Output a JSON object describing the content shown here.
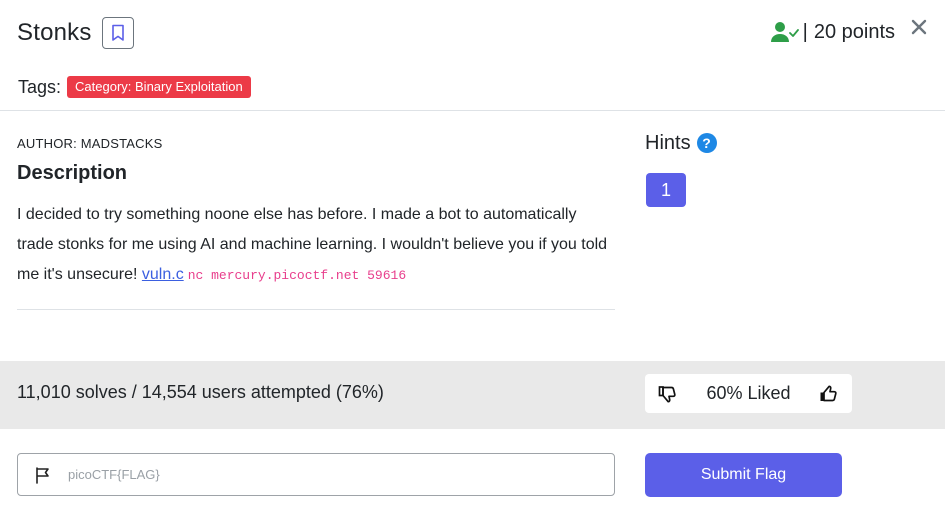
{
  "challenge": {
    "title": "Stonks",
    "points": "20 points",
    "separator": "|",
    "close_glyph": "✕"
  },
  "tags": {
    "label": "Tags:",
    "items": [
      "Category: Binary Exploitation"
    ]
  },
  "description": {
    "author": "AUTHOR: MADSTACKS",
    "heading": "Description",
    "text": "I decided to try something noone else has before. I made a bot to automatically trade stonks for me using AI and machine learning. I wouldn't believe you if you told me it's unsecure!",
    "file_link": "vuln.c",
    "command": "nc mercury.picoctf.net 59616"
  },
  "hints": {
    "label": "Hints",
    "help_glyph": "?",
    "buttons": [
      "1"
    ]
  },
  "stats": {
    "solves_text": "11,010 solves / 14,554 users attempted (76%)",
    "liked_text": "60% Liked"
  },
  "flag": {
    "placeholder": "picoCTF{FLAG}",
    "value": "",
    "submit_label": "Submit Flag"
  },
  "icons": {
    "solved": "user-check-icon",
    "bookmark": "bookmark-icon",
    "close": "close-icon",
    "help": "question-circle-icon",
    "dislike": "thumbs-down-icon",
    "like": "thumbs-up-icon",
    "flag": "flag-icon"
  },
  "colors": {
    "tag_bg": "#ec3a47",
    "primary": "#5b5fe8",
    "solved_green": "#2e9e48",
    "link": "#3b5fe0",
    "code": "#e83e8c",
    "help_blue": "#1e88e5",
    "stats_band": "#e9e9e9"
  }
}
